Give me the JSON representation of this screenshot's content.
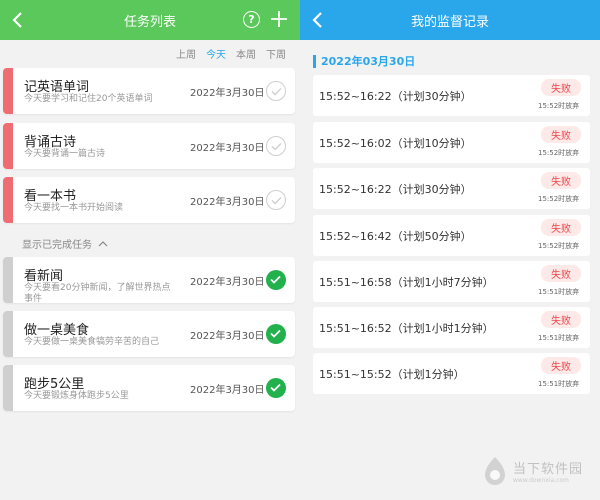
{
  "task_list": {
    "title": "任务列表",
    "help_label": "?",
    "filters": [
      "上周",
      "今天",
      "本周",
      "下周"
    ],
    "active_filter": "今天",
    "pending": [
      {
        "name": "记英语单词",
        "desc": "今天要学习和记住20个英语单词",
        "date": "2022年3月30日"
      },
      {
        "name": "背诵古诗",
        "desc": "今天要背诵一篇古诗",
        "date": "2022年3月30日"
      },
      {
        "name": "看一本书",
        "desc": "今天要找一本书开始阅读",
        "date": "2022年3月30日"
      }
    ],
    "show_done_label": "显示已完成任务",
    "done": [
      {
        "name": "看新闻",
        "desc": "今天要看20分钟新闻，了解世界热点事件",
        "date": "2022年3月30日"
      },
      {
        "name": "做一桌美食",
        "desc": "今天要做一桌美食犒劳辛苦的自己",
        "date": "2022年3月30日"
      },
      {
        "name": "跑步5公里",
        "desc": "今天要锻炼身体跑步5公里",
        "date": "2022年3月30日"
      }
    ],
    "colors": {
      "header": "#5bc85b",
      "pending_bar": "#f06c73",
      "done_bar": "#cfcfcf",
      "check_done": "#23b14d"
    }
  },
  "records": {
    "title": "我的监督记录",
    "date": "2022年03月30日",
    "items": [
      {
        "time": "15:52~16:22（计划30分钟）",
        "status": "失败",
        "note": "15:52时放弃"
      },
      {
        "time": "15:52~16:02（计划10分钟）",
        "status": "失败",
        "note": "15:52时放弃"
      },
      {
        "time": "15:52~16:22（计划30分钟）",
        "status": "失败",
        "note": "15:52时放弃"
      },
      {
        "time": "15:52~16:42（计划50分钟）",
        "status": "失败",
        "note": "15:52时放弃"
      },
      {
        "time": "15:51~16:58（计划1小时7分钟）",
        "status": "失败",
        "note": "15:51时放弃"
      },
      {
        "time": "15:51~16:52（计划1小时1分钟）",
        "status": "失败",
        "note": "15:51时放弃"
      },
      {
        "time": "15:51~15:52（计划1分钟）",
        "status": "失败",
        "note": "15:51时放弃"
      }
    ],
    "colors": {
      "header": "#2aa6ea",
      "badge_bg": "#fde9e8",
      "badge_text": "#f0484e"
    }
  },
  "watermark": {
    "name": "当下软件园",
    "url": "www.downxia.com"
  }
}
